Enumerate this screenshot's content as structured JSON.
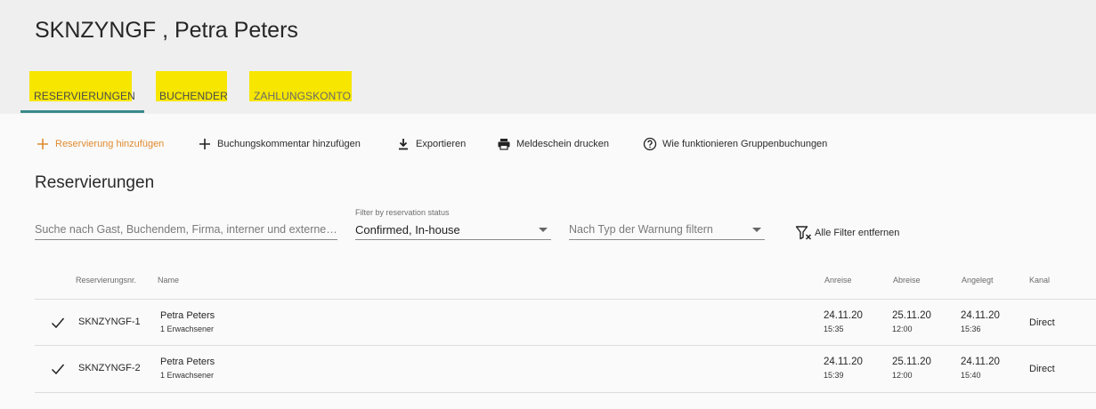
{
  "page": {
    "title": "SKNZYNGF , Petra Peters",
    "colors": {
      "tab_highlight": "#f6e600",
      "tab_ink": "#3a8a8c",
      "primary_action": "#e08a2e"
    }
  },
  "tabs": [
    {
      "label": "RESERVIERUNGEN",
      "active": true
    },
    {
      "label": "BUCHENDER",
      "active": false
    },
    {
      "label": "ZAHLUNGSKONTO",
      "active": false
    }
  ],
  "actions": {
    "add_reservation": {
      "label": "Reservierung hinzufügen",
      "icon": "plus-icon"
    },
    "add_comment": {
      "label": "Buchungskommentar hinzufügen",
      "icon": "plus-icon"
    },
    "export": {
      "label": "Exportieren",
      "icon": "download-icon"
    },
    "print_registration": {
      "label": "Meldeschein drucken",
      "icon": "printer-icon"
    },
    "group_booking_help": {
      "label": "Wie funktionieren Gruppenbuchungen",
      "icon": "help-circle-icon"
    }
  },
  "section": {
    "title": "Reservierungen"
  },
  "filters": {
    "search": {
      "placeholder": "Suche nach Gast, Buchendem, Firma, interner und externer…",
      "value": ""
    },
    "status": {
      "label": "Filter by reservation status",
      "value": "Confirmed, In-house"
    },
    "warning": {
      "placeholder": "Nach Typ der Warnung filtern",
      "value": ""
    },
    "clear_all": {
      "label": "Alle Filter entfernen",
      "icon": "filter-remove-icon"
    }
  },
  "table": {
    "headers": {
      "resnr": "Reservierungsnr.",
      "name": "Name",
      "arrival": "Anreise",
      "departure": "Abreise",
      "created": "Angelegt",
      "channel": "Kanal"
    },
    "rows": [
      {
        "status_icon": "check-icon",
        "resnr": "SKNZYNGF-1",
        "name": "Petra Peters",
        "guests": "1 Erwachsener",
        "arrival_date": "24.11.20",
        "arrival_time": "15:35",
        "departure_date": "25.11.20",
        "departure_time": "12:00",
        "created_date": "24.11.20",
        "created_time": "15:36",
        "channel": "Direct"
      },
      {
        "status_icon": "check-icon",
        "resnr": "SKNZYNGF-2",
        "name": "Petra Peters",
        "guests": "1 Erwachsener",
        "arrival_date": "24.11.20",
        "arrival_time": "15:39",
        "departure_date": "25.11.20",
        "departure_time": "12:00",
        "created_date": "24.11.20",
        "created_time": "15:40",
        "channel": "Direct"
      }
    ]
  }
}
